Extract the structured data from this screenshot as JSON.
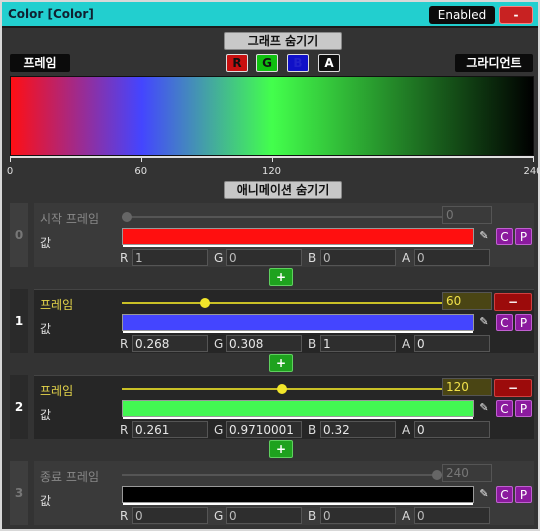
{
  "window": {
    "title": "Color [Color]",
    "enabled_label": "Enabled",
    "close_label": "-"
  },
  "graph_toggle_label": "그래프 숨기기",
  "channels": [
    {
      "label": "R",
      "bg": "#c81010",
      "fg": "#111111"
    },
    {
      "label": "G",
      "bg": "#10c010",
      "fg": "#111111"
    },
    {
      "label": "B",
      "bg": "#1010c8",
      "fg": "#2222cc"
    },
    {
      "label": "A",
      "bg": "#101010",
      "fg": "#ffffff"
    }
  ],
  "left_label": "프레임",
  "right_label": "그라디언트",
  "axis": {
    "ticks": [
      "0",
      "60",
      "120",
      "240"
    ]
  },
  "anim_toggle_label": "애니메이션 숨기기",
  "frames": [
    {
      "index": "0",
      "label": "시작 프레임",
      "frame_value": "0",
      "frame_fraction": 0,
      "value_label": "값",
      "color": "#ff0f0f",
      "components": {
        "R": "1",
        "G": "0",
        "B": "0",
        "A": "0"
      },
      "disabled": true
    },
    {
      "index": "1",
      "label": "프레임",
      "frame_value": "60",
      "frame_fraction": 0.25,
      "value_label": "값",
      "color": "#4445ff",
      "components": {
        "R": "0.268",
        "G": "0.308",
        "B": "1",
        "A": "0"
      },
      "remove_label": "−"
    },
    {
      "index": "2",
      "label": "프레임",
      "frame_value": "120",
      "frame_fraction": 0.5,
      "value_label": "값",
      "color": "#43f752",
      "components": {
        "R": "0.261",
        "G": "0.9710001",
        "B": "0.32",
        "A": "0"
      },
      "remove_label": "−"
    },
    {
      "index": "3",
      "label": "종료 프레임",
      "frame_value": "240",
      "frame_fraction": 1,
      "value_label": "값",
      "color": "#000000",
      "components": {
        "R": "0",
        "G": "0",
        "B": "0",
        "A": "0"
      },
      "disabled": true
    }
  ],
  "add_label": "+",
  "copy_label": "C",
  "paste_label": "P",
  "dropper_icon": "eyedropper-icon"
}
